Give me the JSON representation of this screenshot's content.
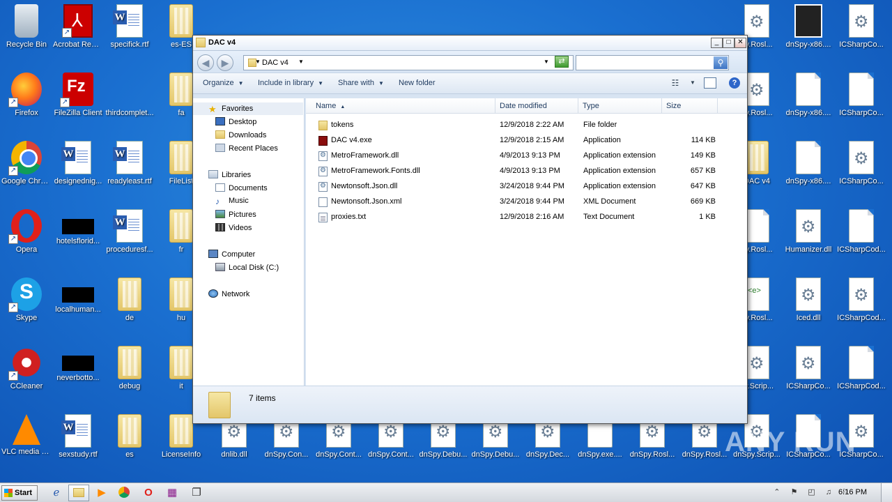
{
  "desktop": {
    "icons": [
      {
        "label": "Recycle Bin",
        "kind": "recycle"
      },
      {
        "label": "Acrobat Reader DC",
        "kind": "pdf"
      },
      {
        "label": "specifick.rtf",
        "kind": "word"
      },
      {
        "label": "es-ES",
        "kind": "folder"
      },
      {
        "label": "Firefox",
        "kind": "firefox"
      },
      {
        "label": "FileZilla Client",
        "kind": "filezilla"
      },
      {
        "label": "thirdcomplet...",
        "kind": "blue"
      },
      {
        "label": "fa",
        "kind": "folder"
      },
      {
        "label": "Google Chrome",
        "kind": "chrome"
      },
      {
        "label": "designednig...",
        "kind": "word"
      },
      {
        "label": "readyleast.rtf",
        "kind": "word"
      },
      {
        "label": "FileList",
        "kind": "folder"
      },
      {
        "label": "Opera",
        "kind": "opera"
      },
      {
        "label": "hotelsflorid...",
        "kind": "black"
      },
      {
        "label": "proceduresf...",
        "kind": "word"
      },
      {
        "label": "fr",
        "kind": "folder"
      },
      {
        "label": "Skype",
        "kind": "skype"
      },
      {
        "label": "localhuman...",
        "kind": "black"
      },
      {
        "label": "de",
        "kind": "folder"
      },
      {
        "label": "hu",
        "kind": "folder"
      },
      {
        "label": "CCleaner",
        "kind": "ccleaner"
      },
      {
        "label": "neverbotto...",
        "kind": "black"
      },
      {
        "label": "debug",
        "kind": "folder"
      },
      {
        "label": "it",
        "kind": "folder"
      },
      {
        "label": "VLC media player",
        "kind": "vlc"
      },
      {
        "label": "sexstudy.rtf",
        "kind": "word"
      },
      {
        "label": "es",
        "kind": "folder"
      },
      {
        "label": "LicenseInfo",
        "kind": "folder"
      },
      {
        "label": "dnlib.dll",
        "kind": "gear"
      },
      {
        "label": "dnSpy.Con...",
        "kind": "gear"
      },
      {
        "label": "dnSpy.Cont...",
        "kind": "gear"
      },
      {
        "label": "dnSpy.Cont...",
        "kind": "gear"
      },
      {
        "label": "dnSpy.Debu...",
        "kind": "gear"
      },
      {
        "label": "dnSpy.Debu...",
        "kind": "gear"
      },
      {
        "label": "dnSpy.Dec...",
        "kind": "gear"
      },
      {
        "label": "dnSpy.exe....",
        "kind": "doc"
      },
      {
        "label": "dnSpy.Rosl...",
        "kind": "gear"
      },
      {
        "label": "dnSpy.Rosl...",
        "kind": "gear"
      },
      {
        "label": "dnSpy.Scrip...",
        "kind": "gear"
      },
      {
        "label": "py.Rosl...",
        "kind": "gear"
      },
      {
        "label": "dnSpy-x86....",
        "kind": "dnspy"
      },
      {
        "label": "ICSharpCo...",
        "kind": "gear"
      },
      {
        "label": "py.Rosl...",
        "kind": "gear"
      },
      {
        "label": "dnSpy-x86....",
        "kind": "doc"
      },
      {
        "label": "ICSharpCo...",
        "kind": "doc"
      },
      {
        "label": "DAC v4",
        "kind": "folder"
      },
      {
        "label": "dnSpy-x86....",
        "kind": "doc"
      },
      {
        "label": "ICSharpCo...",
        "kind": "gear"
      },
      {
        "label": "py.Rosl...",
        "kind": "doc"
      },
      {
        "label": "Humanizer.dll",
        "kind": "gear"
      },
      {
        "label": "ICSharpCod...",
        "kind": "doc"
      },
      {
        "label": "py.Rosl...",
        "kind": "xml"
      },
      {
        "label": "Iced.dll",
        "kind": "gear"
      },
      {
        "label": "ICSharpCod...",
        "kind": "gear"
      },
      {
        "label": "py.Scrip...",
        "kind": "gear"
      },
      {
        "label": "ICSharpCo...",
        "kind": "gear"
      },
      {
        "label": "ICSharpCod...",
        "kind": "doc"
      },
      {
        "label": "ICSharpCo...",
        "kind": "doc"
      },
      {
        "label": "ICSharpCo...",
        "kind": "gear"
      }
    ]
  },
  "window": {
    "title": "DAC v4",
    "controls": {
      "minimize": "_",
      "maximize": "□",
      "close": "✕"
    },
    "address": {
      "crumb": "DAC v4"
    },
    "search": {
      "placeholder": ""
    },
    "toolbar": {
      "organize": "Organize",
      "include": "Include in library",
      "share": "Share with",
      "newfolder": "New folder"
    },
    "nav": {
      "favorites": "Favorites",
      "desktop": "Desktop",
      "downloads": "Downloads",
      "recent": "Recent Places",
      "libraries": "Libraries",
      "documents": "Documents",
      "music": "Music",
      "pictures": "Pictures",
      "videos": "Videos",
      "computer": "Computer",
      "localdisk": "Local Disk (C:)",
      "network": "Network"
    },
    "columns": {
      "name": "Name",
      "date": "Date modified",
      "type": "Type",
      "size": "Size"
    },
    "files": [
      {
        "name": "tokens",
        "date": "12/9/2018 2:22 AM",
        "type": "File folder",
        "size": "",
        "icon": "folder-icon"
      },
      {
        "name": "DAC v4.exe",
        "date": "12/9/2018 2:15 AM",
        "type": "Application",
        "size": "114 KB",
        "icon": "exe-icon"
      },
      {
        "name": "MetroFramework.dll",
        "date": "4/9/2013 9:13 PM",
        "type": "Application extension",
        "size": "149 KB",
        "icon": "dll-icon"
      },
      {
        "name": "MetroFramework.Fonts.dll",
        "date": "4/9/2013 9:13 PM",
        "type": "Application extension",
        "size": "657 KB",
        "icon": "dll-icon"
      },
      {
        "name": "Newtonsoft.Json.dll",
        "date": "3/24/2018 9:44 PM",
        "type": "Application extension",
        "size": "647 KB",
        "icon": "dll-icon"
      },
      {
        "name": "Newtonsoft.Json.xml",
        "date": "3/24/2018 9:44 PM",
        "type": "XML Document",
        "size": "669 KB",
        "icon": "xml-icon"
      },
      {
        "name": "proxies.txt",
        "date": "12/9/2018 2:16 AM",
        "type": "Text Document",
        "size": "1 KB",
        "icon": "txt-icon"
      }
    ],
    "status": {
      "count": "7 items"
    }
  },
  "taskbar": {
    "start": "Start",
    "clock": "6:16 PM"
  },
  "watermark": "ANY RUN"
}
